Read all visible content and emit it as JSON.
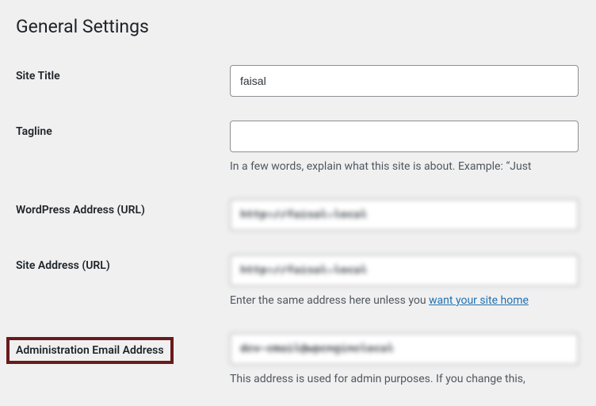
{
  "page_title": "General Settings",
  "fields": {
    "site_title": {
      "label": "Site Title",
      "value": "faisal"
    },
    "tagline": {
      "label": "Tagline",
      "value": "",
      "description": "In a few words, explain what this site is about. Example: “Just"
    },
    "wordpress_url": {
      "label": "WordPress Address (URL)",
      "value": "http://faisal.local"
    },
    "site_url": {
      "label": "Site Address (URL)",
      "value": "http://faisal.local",
      "description_pre": "Enter the same address here unless you ",
      "description_link": "want your site home"
    },
    "admin_email": {
      "label": "Administration Email Address",
      "value": "dev-email@wpenginelocal",
      "description": "This address is used for admin purposes. If you change this,"
    }
  }
}
